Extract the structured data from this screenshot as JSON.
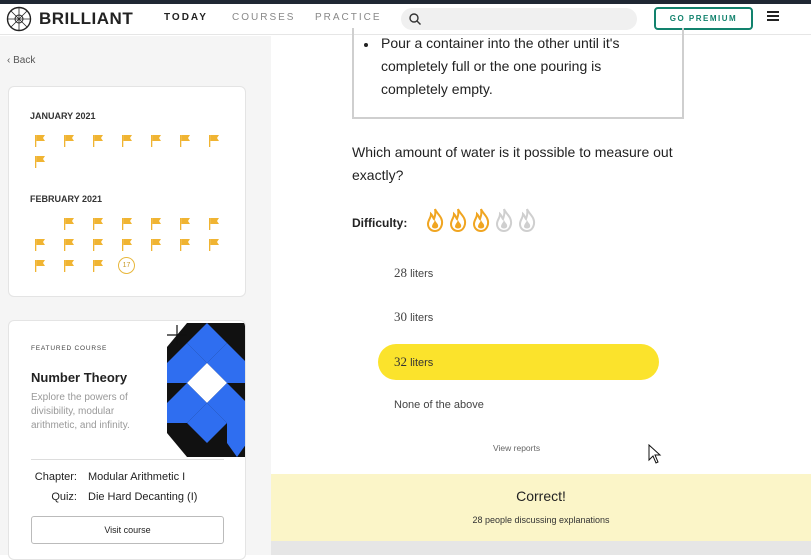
{
  "header": {
    "logo_text": "BRILLIANT",
    "nav": [
      "TODAY",
      "COURSES",
      "PRACTICE"
    ],
    "search_placeholder": "",
    "premium_label": "GO PREMIUM"
  },
  "sidebar": {
    "back_label": "Back",
    "calendar": {
      "months": [
        {
          "label": "JANUARY 2021",
          "flag_days": 8
        },
        {
          "label": "FEBRUARY 2021",
          "flag_days": 16,
          "current_day": "17"
        }
      ]
    },
    "featured": {
      "eyebrow": "FEATURED COURSE",
      "title": "Number Theory",
      "description": "Explore the powers of divisibility, modular arithmetic, and infinity.",
      "chapter_label": "Chapter:",
      "chapter_value": "Modular Arithmetic I",
      "quiz_label": "Quiz:",
      "quiz_value": "Die Hard Decanting (I)",
      "visit_label": "Visit course"
    }
  },
  "problem": {
    "rule_text": "Pour a container into the other until it's completely full or the one pouring is completely empty.",
    "question": "Which amount of water is it possible to measure out exactly?",
    "difficulty_label": "Difficulty:",
    "difficulty_level": 3,
    "difficulty_max": 5,
    "options": [
      {
        "num": "28",
        "unit": "liters",
        "selected": false
      },
      {
        "num": "30",
        "unit": "liters",
        "selected": false
      },
      {
        "num": "32",
        "unit": "liters",
        "selected": true
      },
      {
        "num": "",
        "unit": "None of the above",
        "selected": false
      }
    ],
    "view_reports": "View reports"
  },
  "result": {
    "title": "Correct!",
    "subtitle": "28 people discussing explanations"
  },
  "colors": {
    "accent_yellow": "#fbe32c",
    "flag": "#f0b432",
    "premium_green": "#12826d",
    "result_bg": "#fbf5c8"
  }
}
